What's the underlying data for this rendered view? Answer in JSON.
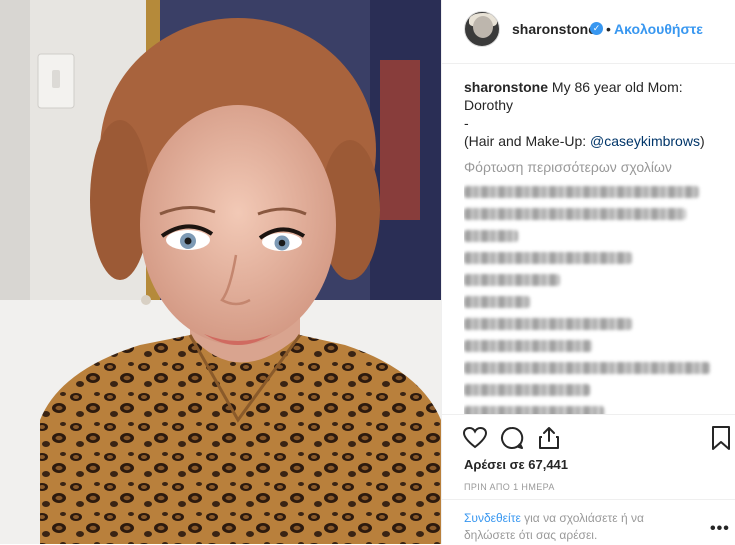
{
  "header": {
    "username": "sharonstone",
    "verified_icon": "verified-badge-icon",
    "separator": "•",
    "follow_label": "Ακολουθήστε"
  },
  "caption": {
    "username": "sharonstone",
    "line1": "My 86 year old Mom: Dorothy",
    "line2": "-",
    "line3_prefix": "(Hair and Make-Up: ",
    "mention": "@caseykimbrows",
    "line3_suffix": ")"
  },
  "comments": {
    "load_more_label": "Φόρτωση περισσότερων σχολίων"
  },
  "actions": {
    "icons": [
      "heart-icon",
      "comment-icon",
      "share-icon",
      "bookmark-icon"
    ],
    "likes_label": "Αρέσει σε 67,441",
    "timestamp": "ΠΡΙΝ ΑΠΟ 1 ΗΜΕΡΑ"
  },
  "login": {
    "link_label": "Συνδεθείτε",
    "text": " για να σχολιάσετε ή να δηλώσετε ότι σας αρέσει.",
    "more_label": "•••"
  },
  "colors": {
    "link": "#3897f0",
    "text": "#262626",
    "muted": "#999999",
    "border": "#efefef"
  }
}
